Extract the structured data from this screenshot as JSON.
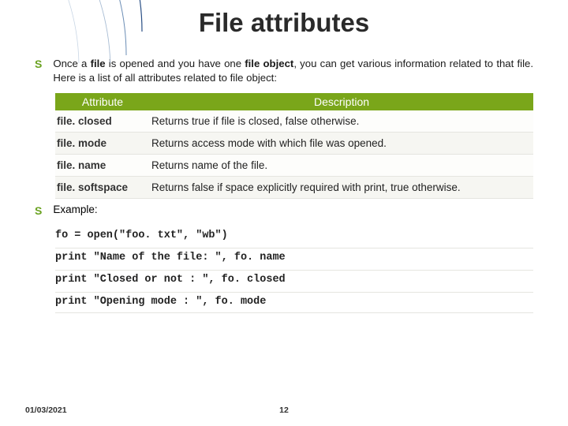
{
  "title": "File attributes",
  "intro_html": "Once a <b>file</b> is opened and you have one <b>file object</b>, you can get various information related to that file. Here is a list of all attributes related to file object:",
  "table": {
    "headers": {
      "attr": "Attribute",
      "desc": "Description"
    },
    "rows": [
      {
        "attr": "file. closed",
        "desc": "Returns true if file is closed, false otherwise."
      },
      {
        "attr": "file. mode",
        "desc": "Returns access mode with which file was opened."
      },
      {
        "attr": "file. name",
        "desc": "Returns name of the file."
      },
      {
        "attr": "file. softspace",
        "desc": "Returns false if space explicitly required with print, true otherwise."
      }
    ]
  },
  "example_label": "Example:",
  "code": [
    "fo = open(\"foo. txt\", \"wb\")",
    "print \"Name of the file: \", fo. name",
    "print \"Closed or not : \", fo. closed",
    "print \"Opening mode : \", fo. mode"
  ],
  "footer": {
    "date": "01/03/2021",
    "page": "12"
  }
}
